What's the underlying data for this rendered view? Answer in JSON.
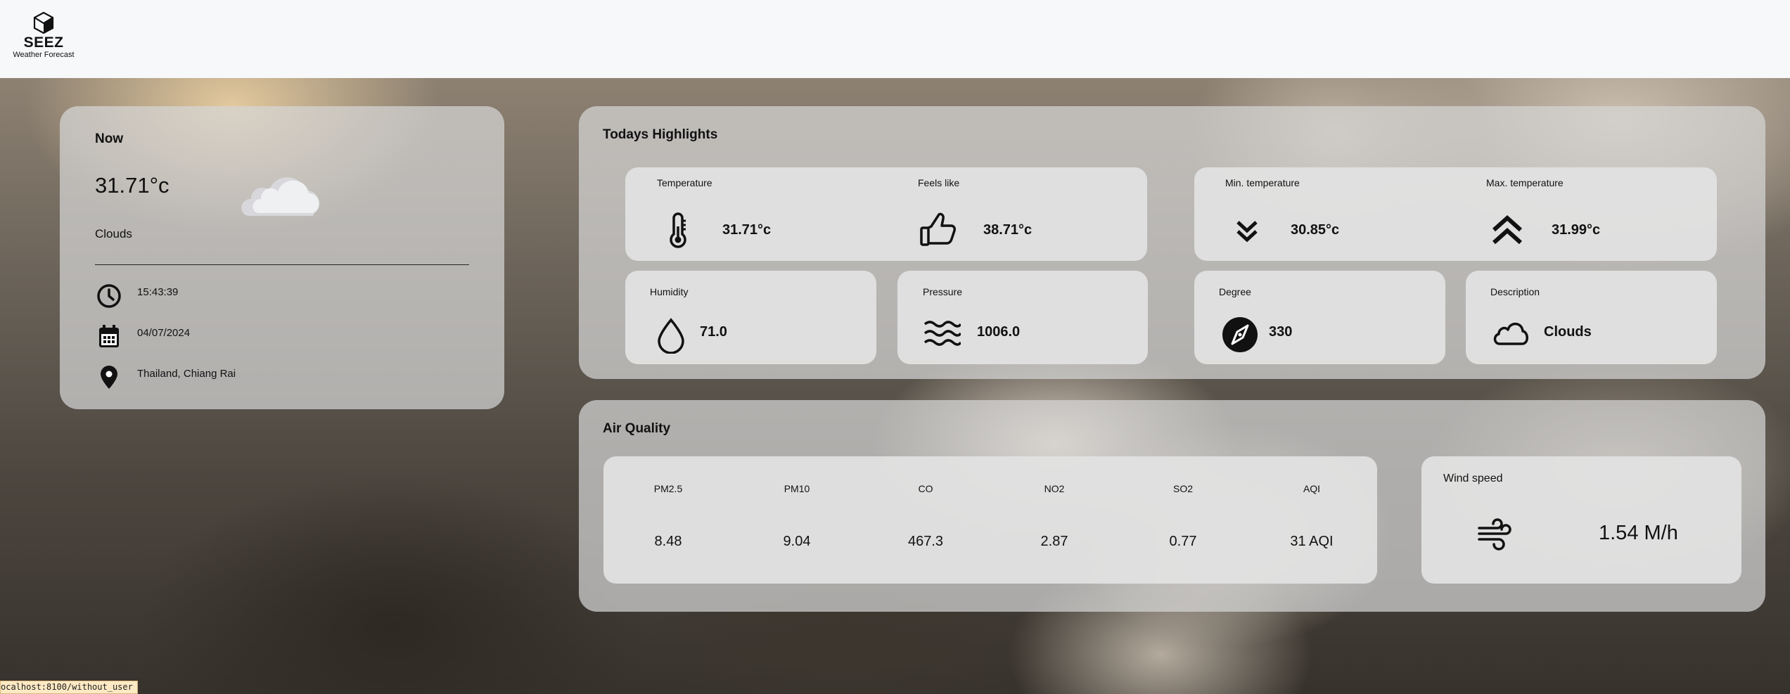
{
  "header": {
    "brand": "SEEZ",
    "subtitle": "Weather Forecast"
  },
  "now": {
    "title": "Now",
    "temperature": "31.71°c",
    "condition": "Clouds",
    "time": "15:43:39",
    "date": "04/07/2024",
    "location": "Thailand, Chiang Rai"
  },
  "highlights": {
    "title": "Todays Highlights",
    "temperature": {
      "label": "Temperature",
      "value": "31.71°c"
    },
    "feels_like": {
      "label": "Feels like",
      "value": "38.71°c"
    },
    "min_temp": {
      "label": "Min. temperature",
      "value": "30.85°c"
    },
    "max_temp": {
      "label": "Max. temperature",
      "value": "31.99°c"
    },
    "humidity": {
      "label": "Humidity",
      "value": "71.0"
    },
    "pressure": {
      "label": "Pressure",
      "value": "1006.0"
    },
    "degree": {
      "label": "Degree",
      "value": "330"
    },
    "description": {
      "label": "Description",
      "value": "Clouds"
    }
  },
  "air_quality": {
    "title": "Air Quality",
    "items": [
      {
        "label": "PM2.5",
        "value": "8.48"
      },
      {
        "label": "PM10",
        "value": "9.04"
      },
      {
        "label": "CO",
        "value": "467.3"
      },
      {
        "label": "NO2",
        "value": "2.87"
      },
      {
        "label": "SO2",
        "value": "0.77"
      },
      {
        "label": "AQI",
        "value": "31 AQI"
      }
    ],
    "wind": {
      "label": "Wind speed",
      "value": "1.54 M/h"
    }
  },
  "status_bar": {
    "url": "ocalhost:8100/without_user"
  },
  "icons": [
    "cube-logo-icon",
    "cloud-icon",
    "clock-icon",
    "calendar-icon",
    "location-pin-icon",
    "thermometer-icon",
    "thumbs-up-icon",
    "chevron-double-down-icon",
    "chevron-double-up-icon",
    "water-drop-icon",
    "waves-icon",
    "compass-icon",
    "wind-icon"
  ]
}
